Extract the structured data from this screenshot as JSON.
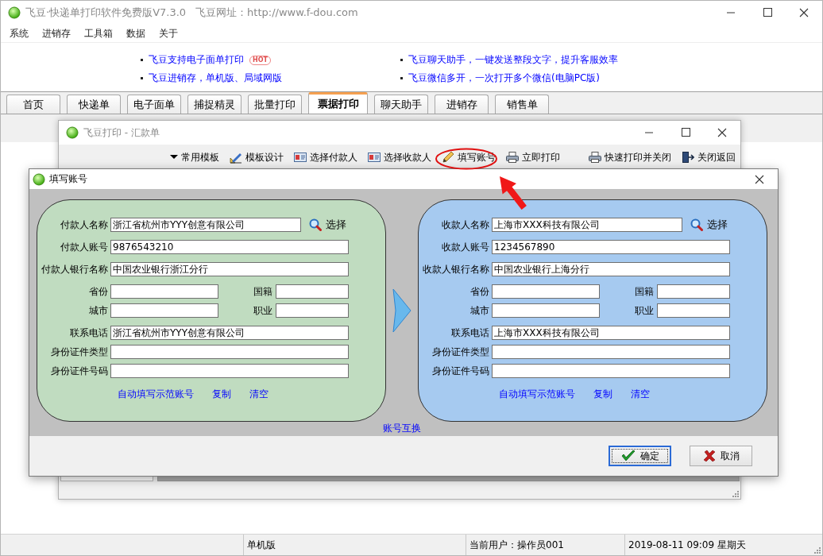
{
  "window": {
    "title": "飞豆·快递单打印软件免费版V7.3.0",
    "website": "飞豆网址：http://www.f-dou.com"
  },
  "menu": [
    "系统",
    "进销存",
    "工具箱",
    "数据",
    "关于"
  ],
  "promos": [
    {
      "text": "飞豆支持电子面单打印",
      "badge": "HOT"
    },
    {
      "text": "飞豆聊天助手，一键发送整段文字，提升客服效率"
    },
    {
      "text": "飞豆进销存，单机版、局域网版"
    },
    {
      "text": "飞豆微信多开，一次打开多个微信(电脑PC版)"
    }
  ],
  "tabs": [
    {
      "label": "首页",
      "selected": false
    },
    {
      "label": "快递单",
      "selected": false
    },
    {
      "label": "电子面单",
      "selected": false
    },
    {
      "label": "捕捉精灵",
      "selected": false
    },
    {
      "label": "批量打印",
      "selected": false
    },
    {
      "label": "票据打印",
      "selected": true
    },
    {
      "label": "聊天助手",
      "selected": false
    },
    {
      "label": "进销存",
      "selected": false
    },
    {
      "label": "销售单",
      "selected": false
    }
  ],
  "sub_window": {
    "title": "飞豆打印 - 汇款单",
    "toolbar": [
      [
        {
          "label": "常用模板",
          "kind": "dropdown"
        },
        {
          "label": "模板设计",
          "kind": "design"
        },
        {
          "label": "选择付款人",
          "kind": "contact"
        },
        {
          "label": "选择收款人",
          "kind": "contact"
        },
        {
          "label": "填写账号",
          "kind": "edit"
        },
        {
          "label": "立即打印",
          "kind": "print"
        }
      ],
      [
        {
          "label": "快速打印并关闭",
          "kind": "print"
        },
        {
          "label": "关闭返回",
          "kind": "exit"
        }
      ]
    ]
  },
  "dialog": {
    "title": "填写账号",
    "panels": [
      {
        "kind": "payer",
        "groups": [
          [
            {
              "kind": "name",
              "fields": [
                {
                  "label": "付款人名称",
                  "value": "浙江省杭州市YYY创意有限公司"
                }
              ],
              "action": "选择"
            }
          ],
          [
            {
              "kind": "full",
              "fields": [
                {
                  "label": "付款人账号",
                  "value": "9876543210"
                }
              ]
            }
          ],
          [
            {
              "kind": "full",
              "fields": [
                {
                  "label": "付款人银行名称",
                  "value": "中国农业银行浙江分行"
                }
              ]
            }
          ],
          [
            {
              "kind": "pair",
              "fields": [
                {
                  "label": "省份"
                },
                {
                  "label": "国籍"
                }
              ]
            },
            {
              "kind": "pair",
              "fields": [
                {
                  "label": "城市"
                },
                {
                  "label": "职业"
                }
              ]
            }
          ],
          [
            {
              "kind": "full",
              "fields": [
                {
                  "label": "联系电话",
                  "value": "浙江省杭州市YYY创意有限公司"
                }
              ]
            },
            {
              "kind": "full",
              "fields": [
                {
                  "label": "身份证件类型"
                }
              ]
            },
            {
              "kind": "full",
              "fields": [
                {
                  "label": "身份证件号码"
                }
              ]
            }
          ]
        ],
        "links": [
          "自动填写示范账号",
          "复制",
          "清空"
        ]
      },
      {
        "kind": "payee",
        "groups": [
          [
            {
              "kind": "name",
              "fields": [
                {
                  "label": "收款人名称",
                  "value": "上海市XXX科技有限公司"
                }
              ],
              "action": "选择"
            }
          ],
          [
            {
              "kind": "full",
              "fields": [
                {
                  "label": "收款人账号",
                  "value": "1234567890"
                }
              ]
            }
          ],
          [
            {
              "kind": "full",
              "fields": [
                {
                  "label": "收款人银行名称",
                  "value": "中国农业银行上海分行"
                }
              ]
            }
          ],
          [
            {
              "kind": "pair",
              "fields": [
                {
                  "label": "省份"
                },
                {
                  "label": "国籍"
                }
              ]
            },
            {
              "kind": "pair",
              "fields": [
                {
                  "label": "城市"
                },
                {
                  "label": "职业"
                }
              ]
            }
          ],
          [
            {
              "kind": "full",
              "fields": [
                {
                  "label": "联系电话",
                  "value": "上海市XXX科技有限公司"
                }
              ]
            },
            {
              "kind": "full",
              "fields": [
                {
                  "label": "身份证件类型"
                }
              ]
            },
            {
              "kind": "full",
              "fields": [
                {
                  "label": "身份证件号码"
                }
              ]
            }
          ]
        ],
        "links": [
          "自动填写示范账号",
          "复制",
          "清空"
        ]
      }
    ],
    "swap_link": "账号互换",
    "buttons": [
      {
        "label": "确定",
        "kind": "ok",
        "focused": true
      },
      {
        "label": "取消",
        "kind": "cancel",
        "focused": false
      }
    ]
  },
  "status_bar": [
    "单机版",
    "当前用户：操作员001",
    "2019-08-11 09:09 星期天"
  ]
}
